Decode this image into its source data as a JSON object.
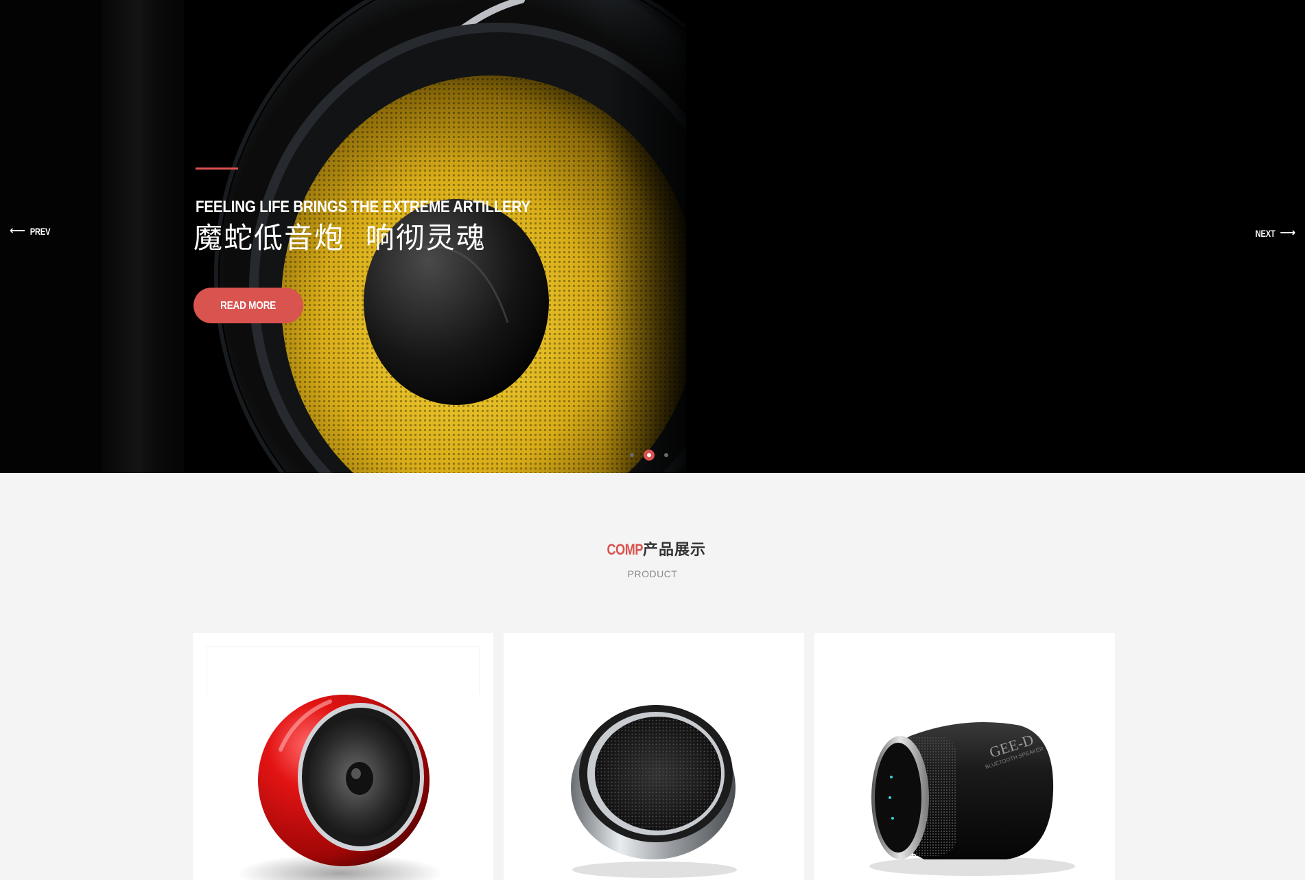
{
  "hero": {
    "subtitle": "FEELING LIFE BRINGS THE EXTREME ARTILLERY",
    "title": "魔蛇低音炮  响彻灵魂",
    "button_label": "READ MORE",
    "prev_label": "PREV",
    "next_label": "NEXT",
    "prev_arrow": "⟵",
    "next_arrow": "⟶",
    "slide_count": 3,
    "active_slide": 2
  },
  "products": {
    "title_accent": "COMP",
    "title_main": "产品展示",
    "subtitle": "PRODUCT",
    "items": [
      {
        "icon": "red-sphere-speaker-image"
      },
      {
        "icon": "round-silver-speaker-image"
      },
      {
        "icon": "gee-d-bluetooth-speaker-image",
        "brand_text": "GEE-D",
        "brand_sub": "BLUETOOTH SPEAKER"
      }
    ]
  },
  "colors": {
    "accent": "#d9534f",
    "page_bg": "#f4f4f4",
    "hero_bg": "#000000",
    "speaker_yellow": "#e0b820"
  }
}
